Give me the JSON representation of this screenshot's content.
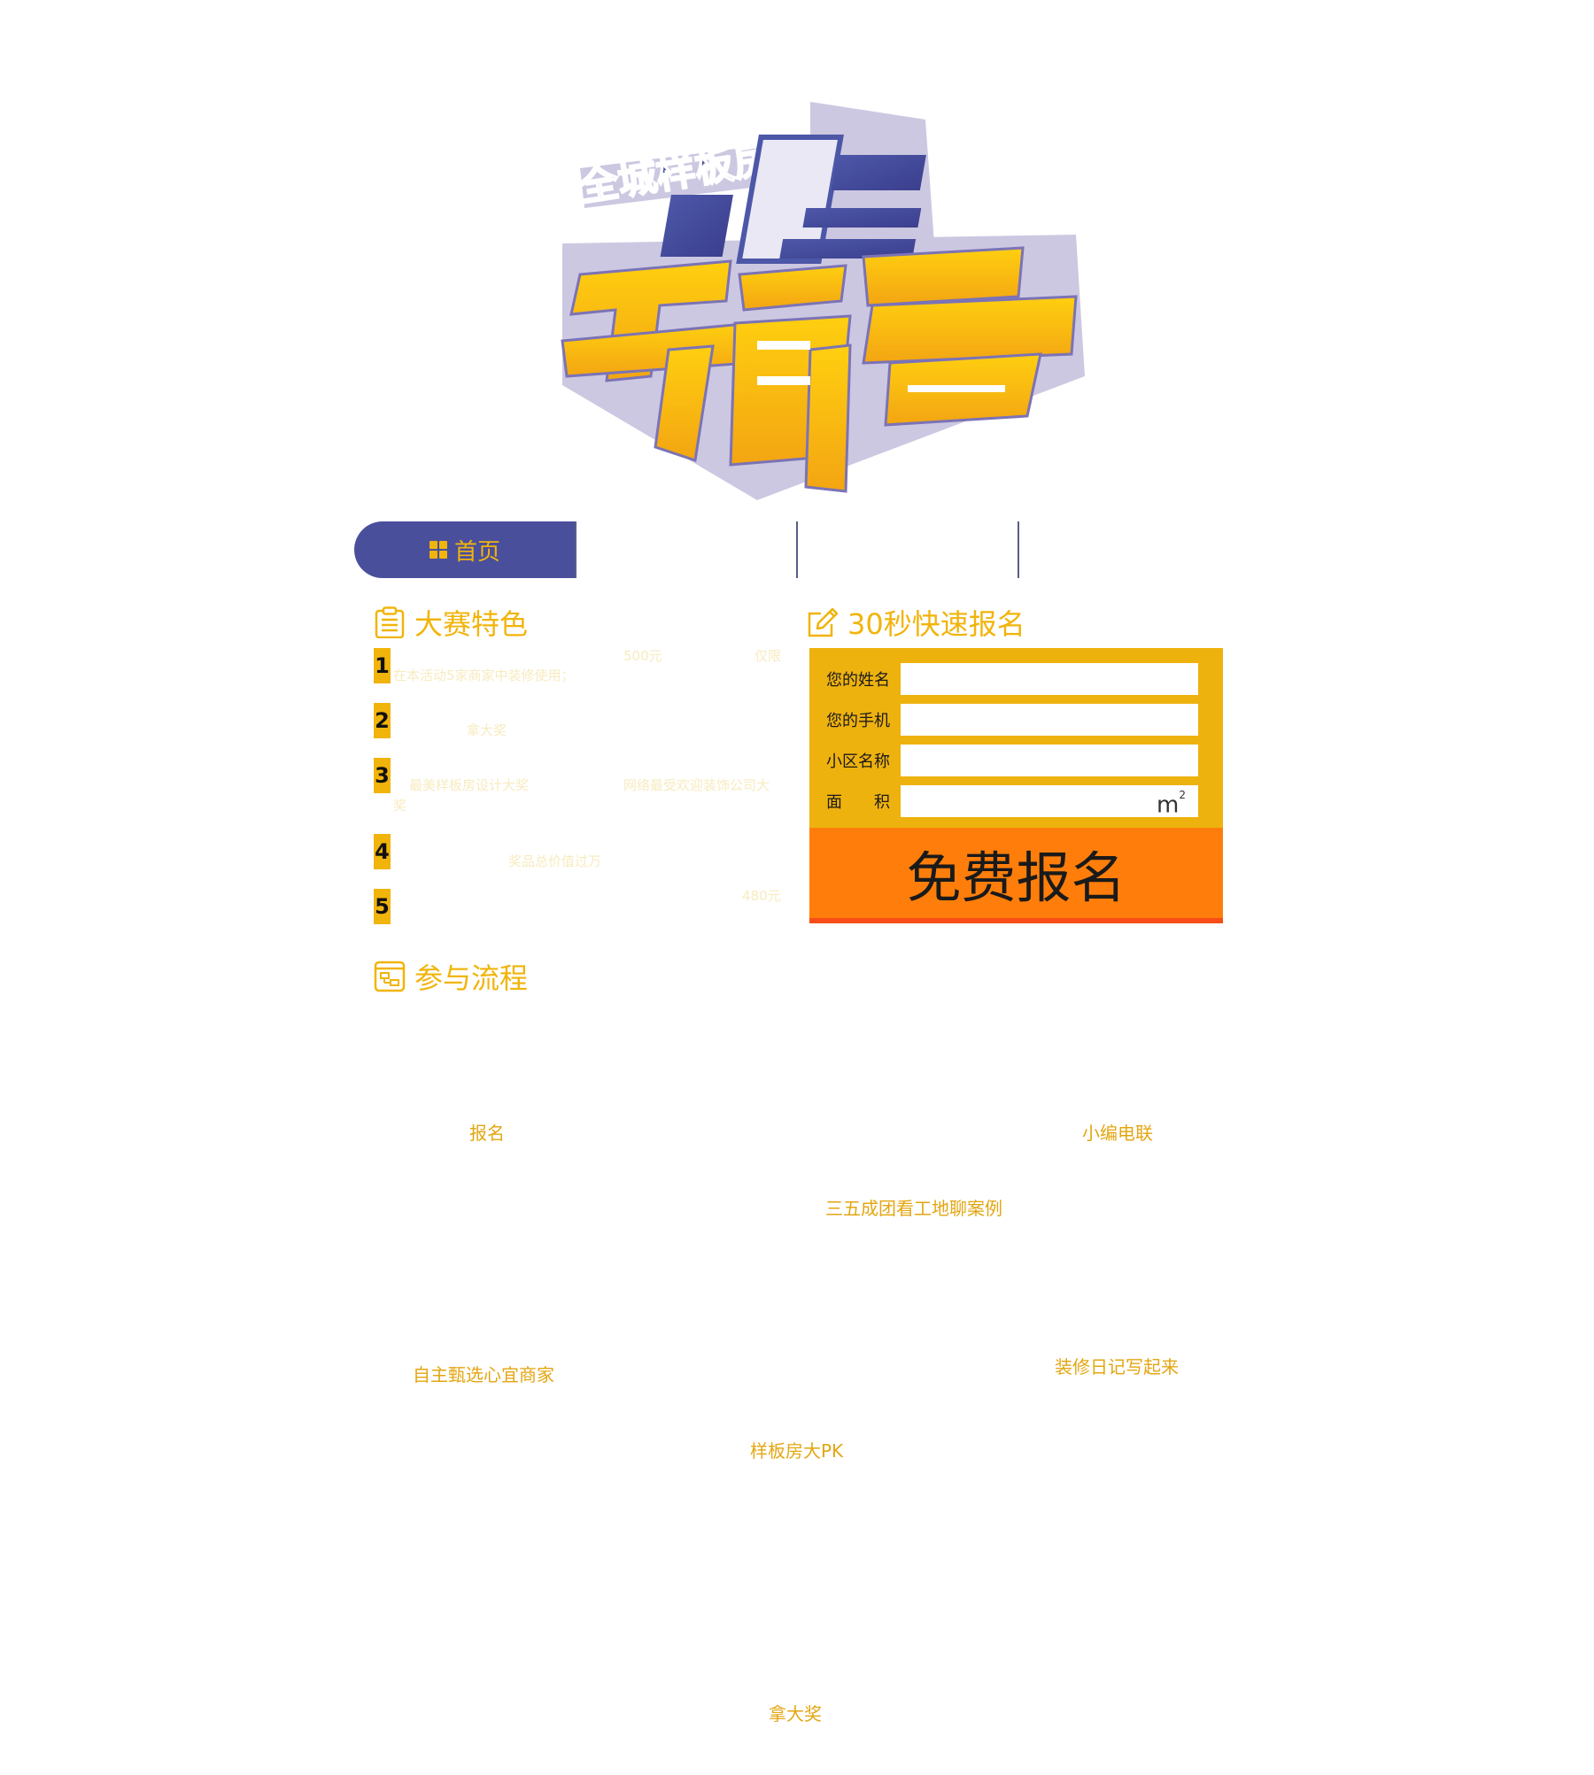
{
  "logo": {
    "line1": "全城样板房",
    "line2": "装修",
    "line3": "争霸赛"
  },
  "nav": {
    "items": [
      {
        "label": "首页"
      },
      {
        "label": ""
      },
      {
        "label": ""
      },
      {
        "label": ""
      }
    ]
  },
  "features": {
    "title": "大赛特色",
    "items": [
      {
        "num": "1",
        "t1": "500元",
        "t2": "仅限",
        "t3": "在本活动5家商家中装修使用；"
      },
      {
        "num": "2",
        "t1": "拿大奖"
      },
      {
        "num": "3",
        "t1": "最美样板房设计大奖",
        "t2": "网络最受欢迎装饰公司大",
        "t3": "奖"
      },
      {
        "num": "4",
        "t1": "奖品总价值过万"
      },
      {
        "num": "5",
        "t1": "480元"
      }
    ]
  },
  "signup": {
    "title": "30秒快速报名",
    "fields": [
      {
        "label": "您的姓名",
        "value": ""
      },
      {
        "label": "您的手机",
        "value": ""
      },
      {
        "label": "小区名称",
        "value": ""
      },
      {
        "label": "面　　积",
        "value": ""
      }
    ],
    "unit": "m",
    "unit_sup": "2",
    "submit": "免费报名"
  },
  "process": {
    "title": "参与流程",
    "steps": [
      "报名",
      "小编电联",
      "三五成团看工地聊案例",
      "自主甄选心宜商家",
      "装修日记写起来",
      "样板房大PK",
      "拿大奖"
    ]
  },
  "colors": {
    "accent": "#f1b40b",
    "nav_active": "#4a4f9c",
    "form_bg": "#eeb20f",
    "button": "#ff7e0b"
  }
}
